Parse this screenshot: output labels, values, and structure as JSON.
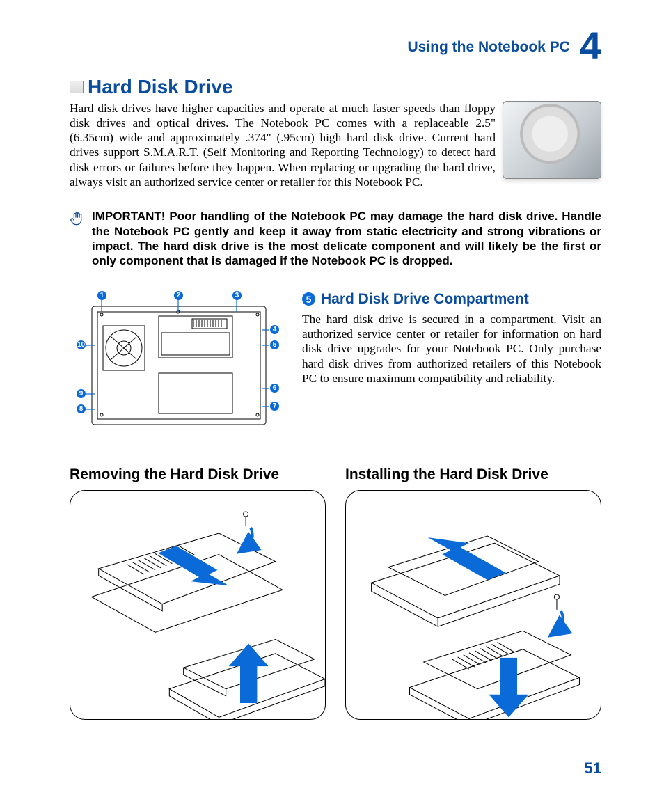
{
  "header": {
    "section_title": "Using the Notebook PC",
    "chapter_number": "4"
  },
  "main_heading": "Hard Disk Drive",
  "intro_paragraph": "Hard disk drives have higher capacities and operate at much faster speeds than floppy disk drives and optical drives. The Notebook PC comes with a replaceable 2.5\" (6.35cm) wide and approximately .374\" (.95cm) high hard disk drive. Current hard drives support S.M.A.R.T. (Self Monitoring and Reporting Technology) to detect hard disk errors or failures before they happen. When replacing or upgrading the hard drive, always visit an authorized service center or retailer for this Notebook PC.",
  "important_note": "IMPORTANT!  Poor handling of the Notebook PC may damage the hard disk drive. Handle the Notebook PC gently and keep it away from static electricity and strong vibrations or impact. The hard disk drive is the most delicate component and will likely be the first or only component that is damaged if the Notebook PC is dropped.",
  "callouts": {
    "1": "1",
    "2": "2",
    "3": "3",
    "4": "4",
    "5": "5",
    "6": "6",
    "7": "7",
    "8": "8",
    "9": "9",
    "10": "10"
  },
  "compartment": {
    "badge": "5",
    "heading": "Hard Disk Drive Compartment",
    "text": "The hard disk drive is secured in a compartment. Visit an authorized service center or retailer for information on hard disk drive upgrades for your Notebook PC. Only purchase hard disk drives from authorized retailers of this Notebook PC to ensure maximum compatibility and reliability."
  },
  "removing_heading": "Removing the Hard Disk Drive",
  "installing_heading": "Installing the Hard Disk Drive",
  "page_number": "51",
  "colors": {
    "brand_blue": "#0a4c9e",
    "callout_blue": "#0a6ad8"
  }
}
